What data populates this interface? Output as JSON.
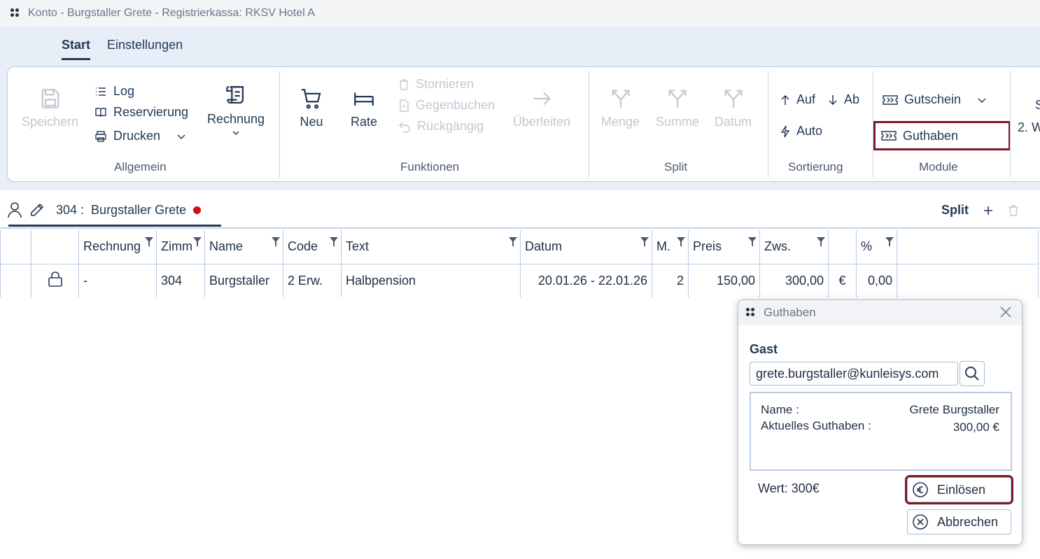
{
  "window": {
    "title": "Konto - Burgstaller Grete - Registrierkassa: RKSV Hotel A"
  },
  "tabs": [
    "Start",
    "Einstellungen"
  ],
  "ribbon": {
    "allgemein": {
      "label": "Allgemein",
      "speichern": "Speichern",
      "log": "Log",
      "reservierung": "Reservierung",
      "drucken": "Drucken",
      "rechnung": "Rechnung"
    },
    "funktionen": {
      "label": "Funktionen",
      "neu": "Neu",
      "rate": "Rate",
      "stornieren": "Stornieren",
      "gegenbuchen": "Gegenbuchen",
      "rueckgaengig": "Rückgängig",
      "ueberleiten": "Überleiten"
    },
    "split": {
      "label": "Split",
      "menge": "Menge",
      "summe": "Summe",
      "datum": "Datum"
    },
    "sortierung": {
      "label": "Sortierung",
      "auf": "Auf",
      "ab": "Ab",
      "auto": "Auto"
    },
    "module": {
      "label": "Module",
      "gutschein": "Gutschein",
      "guthaben": "Guthaben"
    },
    "overflow": {
      "s": "S",
      "w": "2. W"
    }
  },
  "account_tab": {
    "room": "304 :",
    "guest": "Burgstaller Grete"
  },
  "split_toolbar": {
    "label": "Split"
  },
  "table": {
    "headers": [
      "",
      "",
      "Rechnung",
      "Zimm",
      "Name",
      "Code",
      "Text",
      "Datum",
      "M.",
      "Preis",
      "Zws.",
      "",
      "%",
      ""
    ],
    "rows": [
      [
        "",
        "",
        "-",
        "304",
        "Burgstaller",
        "2 Erw.",
        "Halbpension",
        "20.01.26 - 22.01.26",
        "2",
        "150,00",
        "300,00",
        "€",
        "0,00",
        ""
      ]
    ]
  },
  "dialog": {
    "title": "Guthaben",
    "gast_label": "Gast",
    "email": "grete.burgstaller@kunleisys.com",
    "name_label": "Name :",
    "name_value": "Grete Burgstaller",
    "guthaben_label": "Aktuelles Guthaben :",
    "guthaben_value": "300,00 €",
    "wert": "Wert: 300€",
    "einloesen": "Einlösen",
    "abbrechen": "Abbrechen"
  },
  "colors": {
    "accent": "#243a56",
    "highlight": "#7a1a26",
    "unsaved_dot": "#d10d0d",
    "ribbon_bg": "#e8eef7"
  }
}
